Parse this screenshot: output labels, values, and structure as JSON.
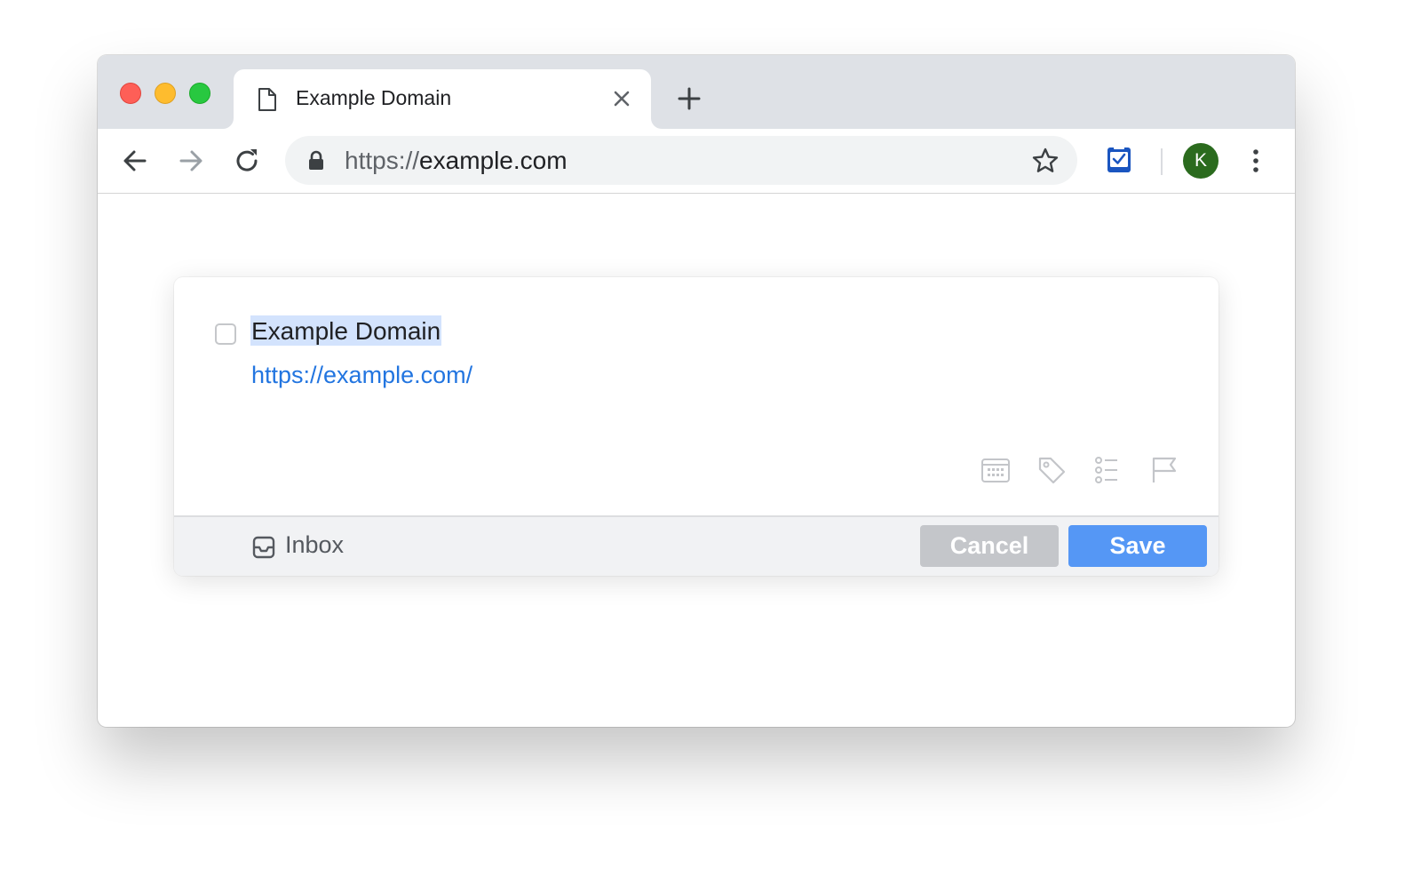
{
  "tab": {
    "title": "Example Domain",
    "icon": "document-icon"
  },
  "address_bar": {
    "scheme": "https://",
    "host": "example.com"
  },
  "profile": {
    "initial": "K",
    "color": "#2b6b1e"
  },
  "task": {
    "title": "Example Domain",
    "link": "https://example.com/",
    "completed": false,
    "tools": [
      "calendar-icon",
      "tag-icon",
      "checklist-icon",
      "flag-icon"
    ]
  },
  "footer": {
    "list_name": "Inbox",
    "cancel_label": "Cancel",
    "save_label": "Save"
  },
  "colors": {
    "accent": "#5597f5",
    "link": "#2275e0",
    "selection": "#d3e3fd"
  }
}
